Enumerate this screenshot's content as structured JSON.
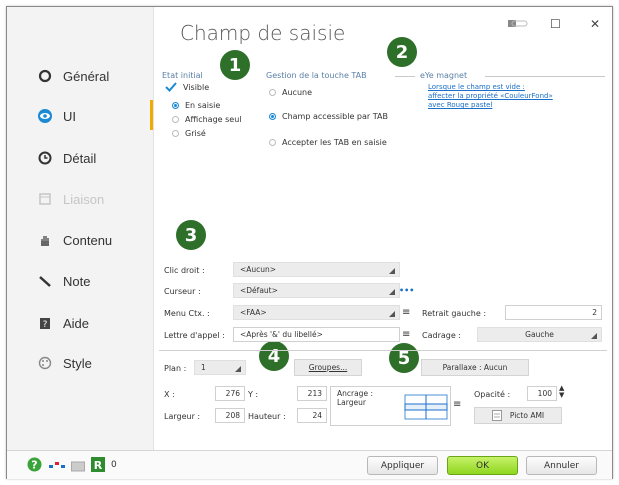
{
  "window": {
    "title": "Champ de saisie",
    "controls": {
      "min": "▭",
      "max": "☐",
      "close": "✕"
    }
  },
  "sidebar": {
    "items": [
      {
        "label": "Général",
        "icon": "circle-o-icon"
      },
      {
        "label": "UI",
        "icon": "eye-icon"
      },
      {
        "label": "Détail",
        "icon": "clock-icon"
      },
      {
        "label": "Liaison",
        "icon": "table-icon"
      },
      {
        "label": "Contenu",
        "icon": "hand-icon"
      },
      {
        "label": "Note",
        "icon": "pen-icon"
      },
      {
        "label": "Aide",
        "icon": "help-book-icon"
      },
      {
        "label": "Style",
        "icon": "palette-icon"
      }
    ]
  },
  "badges": [
    "1",
    "2",
    "3",
    "4",
    "5"
  ],
  "etat_initial": {
    "title": "Etat initial",
    "visible": "Visible",
    "options": [
      "En saisie",
      "Affichage seul",
      "Grisé"
    ]
  },
  "gestion_tab": {
    "title": "Gestion de la touche TAB",
    "options": [
      "Aucune",
      "Champ accessible par TAB",
      "Accepter les TAB en saisie"
    ]
  },
  "magnet": {
    "title": "eYe magnet",
    "link1": "Lorsque le champ est vide :",
    "link2": "affecter la propriété «CouleurFond»",
    "link3": "avec Rouge pastel"
  },
  "form": {
    "clic_droit_label": "Clic droit :",
    "clic_droit_value": "<Aucun>",
    "curseur_label": "Curseur :",
    "curseur_value": "<Défaut>",
    "menu_label": "Menu Ctx. :",
    "menu_value": "<FAA>",
    "lettre_label": "Lettre d'appel :",
    "lettre_value": "<Après '&' du libellé>",
    "retrait_label": "Retrait gauche :",
    "retrait_value": "2",
    "cadrage_label": "Cadrage :",
    "cadrage_value": "Gauche",
    "plan_label": "Plan :",
    "plan_value": "1",
    "groupes_label": "Groupes...",
    "parallaxe_label": "Parallaxe : Aucun",
    "x_label": "X :",
    "x_value": "276",
    "y_label": "Y :",
    "y_value": "213",
    "ancrage_label": "Ancrage :",
    "ancrage_value": "Largeur",
    "opacite_label": "Opacité :",
    "opacite_value": "100",
    "largeur_label": "Largeur :",
    "largeur_value": "208",
    "hauteur_label": "Hauteur :",
    "hauteur_value": "24",
    "picto_label": "Picto AMI"
  },
  "footer": {
    "count": "0",
    "apply": "Appliquer",
    "ok": "OK",
    "cancel": "Annuler"
  },
  "colors": {
    "accent": "#f2a900",
    "badge": "#2e6f2a",
    "link": "#1a6fc9",
    "ok_button": "#8fd61f"
  }
}
